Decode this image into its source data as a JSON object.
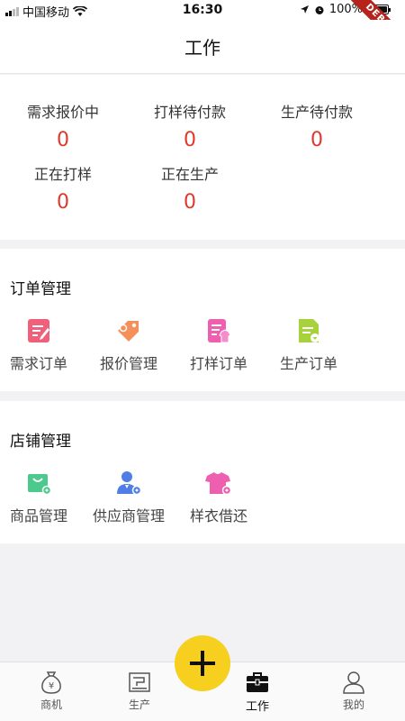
{
  "status_bar": {
    "carrier": "中国移动",
    "time": "16:30",
    "battery": "100%",
    "debug_banner": "DEBUG"
  },
  "header": {
    "title": "工作"
  },
  "stats": [
    {
      "label": "需求报价中",
      "value": "0"
    },
    {
      "label": "打样待付款",
      "value": "0"
    },
    {
      "label": "生产待付款",
      "value": "0"
    },
    {
      "label": "正在打样",
      "value": "0"
    },
    {
      "label": "正在生产",
      "value": "0"
    }
  ],
  "order_section": {
    "title": "订单管理",
    "items": [
      {
        "label": "需求订单",
        "icon": "edit-document-icon"
      },
      {
        "label": "报价管理",
        "icon": "price-tag-icon"
      },
      {
        "label": "打样订单",
        "icon": "sample-order-icon"
      },
      {
        "label": "生产订单",
        "icon": "production-order-icon"
      }
    ]
  },
  "store_section": {
    "title": "店铺管理",
    "items": [
      {
        "label": "商品管理",
        "icon": "product-bag-icon"
      },
      {
        "label": "供应商管理",
        "icon": "supplier-person-icon"
      },
      {
        "label": "样衣借还",
        "icon": "sample-shirt-icon"
      }
    ]
  },
  "bottom_nav": {
    "items": [
      {
        "label": "商机",
        "icon": "money-bag-icon"
      },
      {
        "label": "生产",
        "icon": "sewing-machine-icon"
      },
      {
        "label": "工作",
        "icon": "briefcase-icon",
        "active": true
      },
      {
        "label": "我的",
        "icon": "user-icon"
      }
    ],
    "fab_icon": "plus-icon"
  },
  "colors": {
    "stat_value": "#e0392c",
    "fab": "#f6cf1f",
    "debug_ribbon": "#b5231b"
  }
}
